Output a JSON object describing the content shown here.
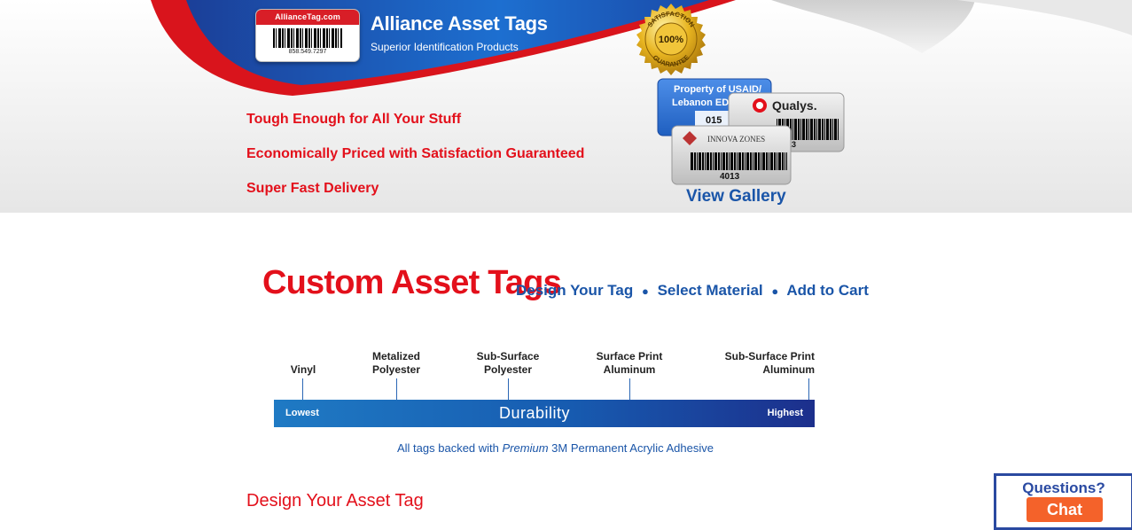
{
  "header": {
    "logo_label": "AllianceTag.com",
    "logo_phone": "858.549.7297",
    "brand_title": "Alliance Asset Tags",
    "brand_subtitle": "Superior Identification Products",
    "taglines": [
      "Tough Enough for All Your Stuff",
      "Economically Priced with Satisfaction Guaranteed",
      "Super Fast Delivery"
    ],
    "seal": {
      "top_text": "SATISFACTION",
      "center_text": "100%",
      "bottom_text": "GUARANTEE"
    },
    "gallery": {
      "tag1_line1": "Property of USAID/",
      "tag1_line2": "Lebanon ED",
      "tag1_num": "015",
      "tag2_brand": "Qualys.",
      "tag2_num": "013",
      "tag3_brand": "INNOVA ZONES",
      "tag3_num": "4013",
      "link_label": "View Gallery"
    }
  },
  "main": {
    "title": "Custom Asset Tags",
    "steps": [
      "Design Your Tag",
      "Select Material",
      "Add to Cart"
    ],
    "step_separator": "●",
    "materials": [
      {
        "line1": "",
        "line2": "Vinyl"
      },
      {
        "line1": "Metalized",
        "line2": "Polyester"
      },
      {
        "line1": "Sub-Surface",
        "line2": "Polyester"
      },
      {
        "line1": "Surface Print",
        "line2": "Aluminum"
      },
      {
        "line1": "Sub-Surface Print",
        "line2": "Aluminum"
      }
    ],
    "durability": {
      "low": "Lowest",
      "label": "Durability",
      "high": "Highest"
    },
    "adhesive": {
      "prefix": "All tags backed with ",
      "emphasis": "Premium",
      "suffix": " 3M Permanent Acrylic Adhesive"
    },
    "design_heading": "Design Your Asset Tag"
  },
  "chat": {
    "question": "Questions?",
    "button_label": "Chat"
  },
  "colors": {
    "brand_red": "#e3101b",
    "brand_blue": "#1a55a8",
    "chat_orange": "#f4622a"
  }
}
